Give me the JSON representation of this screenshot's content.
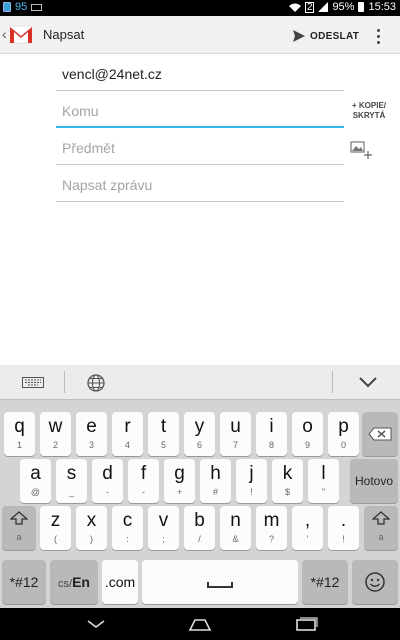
{
  "statusbar": {
    "notif_count": "95",
    "sim_label": "2",
    "battery": "95%",
    "time": "15:53"
  },
  "actionbar": {
    "title": "Napsat",
    "send_label": "ODESLAT",
    "icons": [
      "back-chevron-icon",
      "gmail-logo-icon",
      "send-icon",
      "overflow-menu-icon"
    ]
  },
  "compose": {
    "from_value": "vencl@24net.cz",
    "to_placeholder": "Komu",
    "cc_line1": "+ KOPIE/",
    "cc_line2": "SKRYTÁ",
    "subject_placeholder": "Předmět",
    "body_placeholder": "Napsat zprávu"
  },
  "keyboard": {
    "row1": [
      {
        "m": "q",
        "s": "1"
      },
      {
        "m": "w",
        "s": "2"
      },
      {
        "m": "e",
        "s": "3"
      },
      {
        "m": "r",
        "s": "4"
      },
      {
        "m": "t",
        "s": "5"
      },
      {
        "m": "y",
        "s": "6"
      },
      {
        "m": "u",
        "s": "7"
      },
      {
        "m": "i",
        "s": "8"
      },
      {
        "m": "o",
        "s": "9"
      },
      {
        "m": "p",
        "s": "0"
      }
    ],
    "row2": [
      {
        "m": "a",
        "s": "@"
      },
      {
        "m": "s",
        "s": "_"
      },
      {
        "m": "d",
        "s": "-"
      },
      {
        "m": "f",
        "s": "-"
      },
      {
        "m": "g",
        "s": "+"
      },
      {
        "m": "h",
        "s": "#"
      },
      {
        "m": "j",
        "s": "!"
      },
      {
        "m": "k",
        "s": "$"
      },
      {
        "m": "l",
        "s": "\""
      }
    ],
    "done_label": "Hotovo",
    "row3": [
      {
        "m": "z",
        "s": "("
      },
      {
        "m": "x",
        "s": ")"
      },
      {
        "m": "c",
        "s": ":"
      },
      {
        "m": "v",
        "s": ";"
      },
      {
        "m": "b",
        "s": "/"
      },
      {
        "m": "n",
        "s": "&"
      },
      {
        "m": "m",
        "s": "?"
      },
      {
        "m": ",",
        "s": "'"
      },
      {
        "m": ".",
        "s": "!"
      }
    ],
    "shift_sub": "a",
    "symbols_label": "*#12",
    "lang_label_1": "cs/",
    "lang_label_2": "En",
    "dotcom_label": ".com"
  },
  "colors": {
    "accent": "#33b5e5",
    "gmail_red": "#d93025"
  }
}
